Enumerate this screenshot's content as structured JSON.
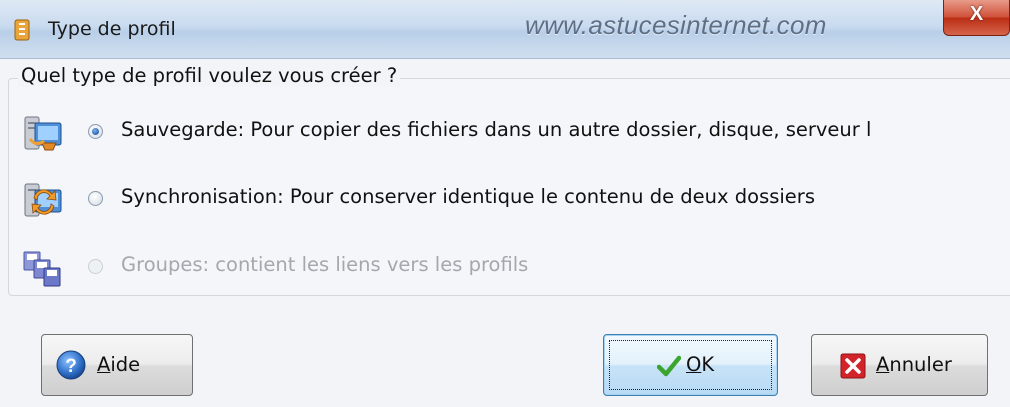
{
  "window": {
    "title": "Type de profil",
    "watermark": "www.astucesinternet.com",
    "close_label": "X"
  },
  "group": {
    "title": "Quel type de profil voulez vous créer ?"
  },
  "options": [
    {
      "label": "Sauvegarde: Pour copier des fichiers dans un autre dossier, disque, serveur l",
      "checked": true,
      "enabled": true,
      "icon": "backup-icon"
    },
    {
      "label": "Synchronisation: Pour conserver identique le contenu de deux dossiers",
      "checked": false,
      "enabled": true,
      "icon": "sync-icon"
    },
    {
      "label": "Groupes: contient les liens vers les profils",
      "checked": false,
      "enabled": false,
      "icon": "groups-icon"
    }
  ],
  "buttons": {
    "help": {
      "mnemonic": "A",
      "rest": "ide",
      "icon": "help-icon"
    },
    "ok": {
      "mnemonic": "O",
      "rest": "K",
      "icon": "checkmark-icon"
    },
    "cancel": {
      "mnemonic": "A",
      "rest": "nnuler",
      "icon": "close-red-icon"
    }
  },
  "colors": {
    "accent": "#2a62b0",
    "close_red": "#c8392a",
    "ok_check": "#3aa52f"
  }
}
